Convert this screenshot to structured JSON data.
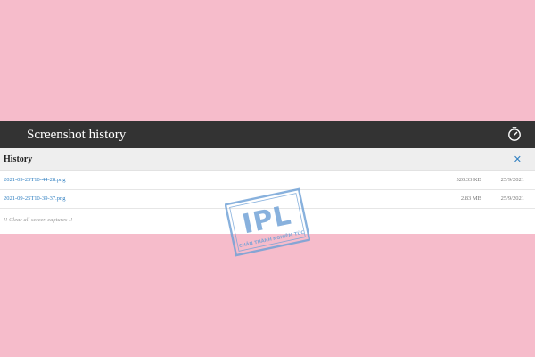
{
  "app": {
    "title": "Screenshot history"
  },
  "header": {
    "timer_icon": "timer-icon"
  },
  "history": {
    "heading": "History",
    "close_label": "✕",
    "items": [
      {
        "name": "2021-09-25T10-44-28.png",
        "size": "520.33 KB",
        "date": "25/9/2021"
      },
      {
        "name": "2021-09-25T10-39-37.png",
        "size": "2.83 MB",
        "date": "25/9/2021"
      }
    ],
    "clear_label": "!! Clear all screen captures !!"
  },
  "watermark": {
    "brand": "IPL",
    "tagline_left": "CHÂN THÀNH",
    "tagline_right": "NGHIÊM TÚC"
  },
  "colors": {
    "page_background": "#f6bccb",
    "header_background": "#333333",
    "link": "#2f7fc1",
    "watermark": "#6ea0d6"
  }
}
